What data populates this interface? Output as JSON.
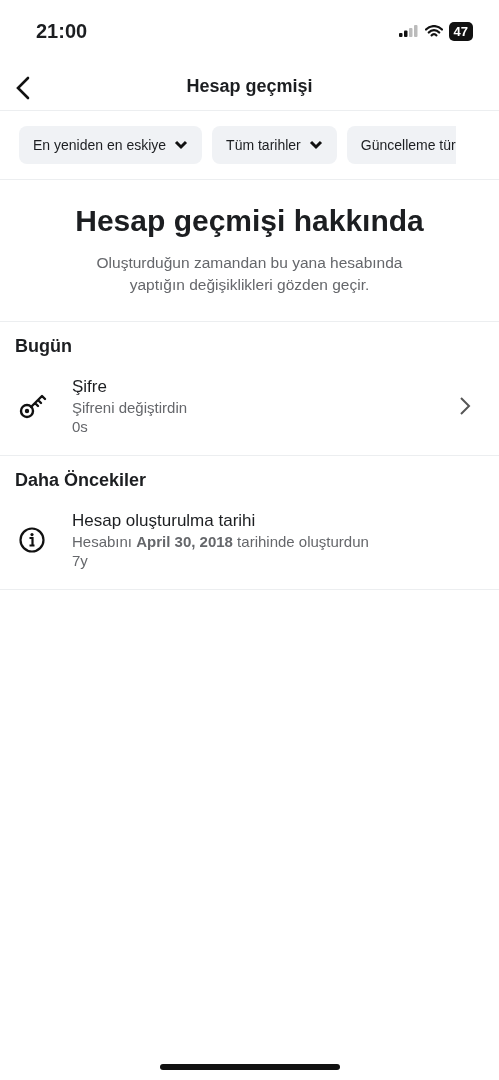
{
  "status_bar": {
    "time": "21:00",
    "battery": "47"
  },
  "header": {
    "title": "Hesap geçmişi"
  },
  "filters": [
    {
      "label": "En yeniden en eskiye",
      "has_caret": true
    },
    {
      "label": "Tüm tarihler",
      "has_caret": true
    },
    {
      "label": "Güncelleme tür",
      "has_caret": false
    }
  ],
  "intro": {
    "title": "Hesap geçmişi hakkında",
    "text": "Oluşturduğun zamandan bu yana hesabında yaptığın değişiklikleri gözden geçir."
  },
  "sections": [
    {
      "title": "Bugün",
      "items": [
        {
          "kind": "key",
          "title": "Şifre",
          "text": "Şifreni değiştirdin",
          "time": "0s",
          "chevron": true
        }
      ]
    },
    {
      "title": "Daha Öncekiler",
      "items": [
        {
          "kind": "info",
          "title": "Hesap oluşturulma tarihi",
          "text": "Hesabını **April 30, 2018** tarihinde oluşturdun",
          "time": "7y",
          "chevron": false
        }
      ]
    }
  ]
}
